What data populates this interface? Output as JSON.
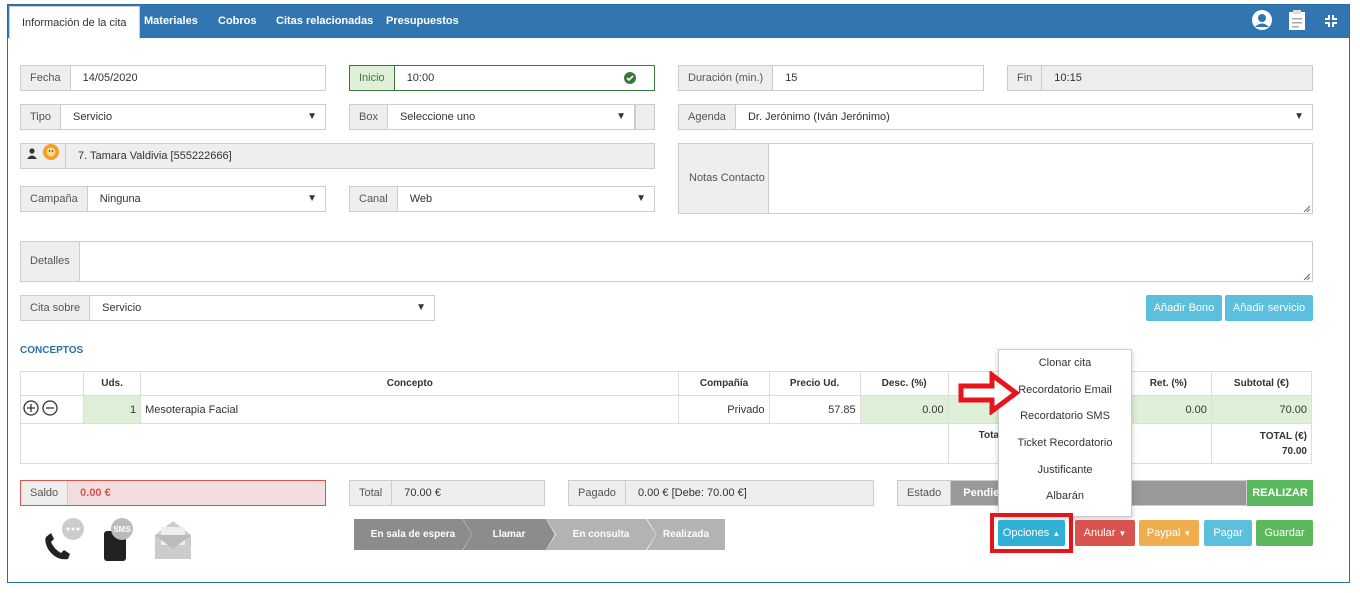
{
  "tabs": [
    "Información de la cita",
    "Materiales",
    "Cobros",
    "Citas relacionadas",
    "Presupuestos"
  ],
  "form": {
    "fecha_label": "Fecha",
    "fecha_value": "14/05/2020",
    "inicio_label": "Inicio",
    "inicio_value": "10:00",
    "duracion_label": "Duración (min.)",
    "duracion_value": "15",
    "fin_label": "Fin",
    "fin_value": "10:15",
    "tipo_label": "Tipo",
    "tipo_value": "Servicio",
    "box_label": "Box",
    "box_value": "Seleccione uno",
    "agenda_label": "Agenda",
    "agenda_value": "Dr. Jerónimo (Iván Jerónimo)",
    "contacto_value": "7. Tamara Valdivia [555222666]",
    "notas_label": "Notas Contacto",
    "campana_label": "Campaña",
    "campana_value": "Ninguna",
    "canal_label": "Canal",
    "canal_value": "Web",
    "detalles_label": "Detalles",
    "cita_sobre_label": "Cita sobre",
    "cita_sobre_value": "Servicio"
  },
  "buttons": {
    "anadir_bono": "Añadir Bono",
    "anadir_servicio": "Añadir servicio",
    "realizar": "REALIZAR",
    "opciones": "Opciones",
    "anular": "Anular",
    "paypal": "Paypal",
    "pagar": "Pagar",
    "guardar": "Guardar"
  },
  "conceptos": {
    "title": "CONCEPTOS",
    "headers": [
      "Uds.",
      "Concepto",
      "Compañía",
      "Precio Ud.",
      "Desc. (%)",
      "Ret. (%)",
      "Subtotal (€)"
    ],
    "row": {
      "uds": "1",
      "concepto": "Mesoterapia Facial",
      "compania": "Privado",
      "precio": "57.85",
      "desc": "0.00",
      "ret": "0.00",
      "subtotal": "70.00"
    },
    "total_label_partial": "Total",
    "total_label": "TOTAL (€)",
    "total_value": "70.00"
  },
  "summary": {
    "saldo_label": "Saldo",
    "saldo_value": "0.00 €",
    "total_label": "Total",
    "total_value": "70.00 €",
    "pagado_label": "Pagado",
    "pagado_value": "0.00 € [Debe: 70.00 €]",
    "estado_label": "Estado",
    "estado_value": "Pendient"
  },
  "steps": [
    "En sala de espera",
    "Llamar",
    "En consulta",
    "Realizada"
  ],
  "menu": [
    "Clonar cita",
    "Recordatorio Email",
    "Recordatorio SMS",
    "Ticket Recordatorio",
    "Justificante",
    "Albarán"
  ],
  "icons": {
    "sms_text": "SMS"
  },
  "colors": {
    "primary": "#3276b1",
    "info": "#5bc0de",
    "danger": "#d9534f",
    "warning": "#f0ad4e",
    "success": "#5cb85c",
    "highlight": "#e8141c"
  }
}
